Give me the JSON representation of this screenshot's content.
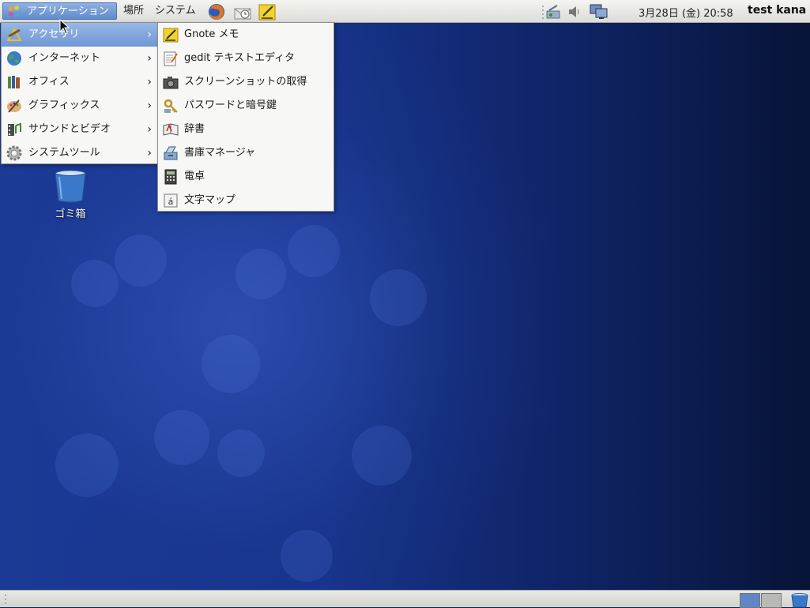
{
  "top_panel": {
    "menus": [
      {
        "label": "アプリケーション"
      },
      {
        "label": "場所"
      },
      {
        "label": "システム"
      }
    ],
    "clock": "3月28日 (金) 20:58",
    "user": "test kana"
  },
  "apps_menu": {
    "items": [
      {
        "label": "アクセサリ"
      },
      {
        "label": "インターネット"
      },
      {
        "label": "オフィス"
      },
      {
        "label": "グラフィックス"
      },
      {
        "label": "サウンドとビデオ"
      },
      {
        "label": "システムツール"
      }
    ]
  },
  "accessories_menu": {
    "items": [
      {
        "label": "Gnote メモ"
      },
      {
        "label": "gedit テキストエディタ"
      },
      {
        "label": "スクリーンショットの取得"
      },
      {
        "label": "パスワードと暗号鍵"
      },
      {
        "label": "辞書"
      },
      {
        "label": "書庫マネージャ"
      },
      {
        "label": "電卓"
      },
      {
        "label": "文字マップ"
      }
    ]
  },
  "desktop": {
    "trash_label": "ゴミ箱"
  },
  "colors": {
    "highlight": "#6f97d4",
    "panel": "#e6e6e3",
    "desktop": "#17338a"
  }
}
